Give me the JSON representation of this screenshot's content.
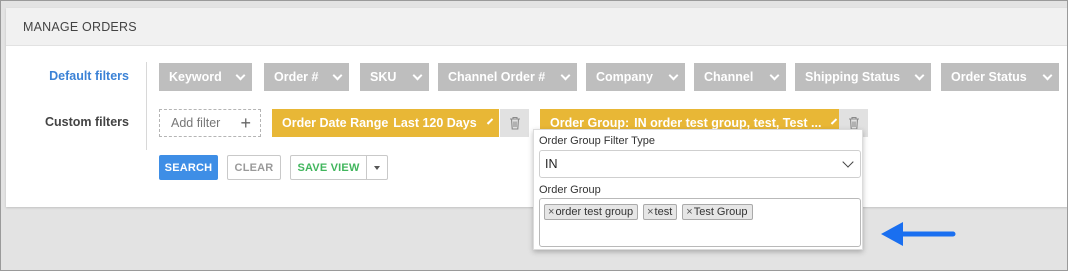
{
  "header": {
    "title": "MANAGE ORDERS"
  },
  "labels": {
    "default_filters": "Default filters",
    "custom_filters": "Custom filters"
  },
  "default_filters": [
    {
      "label": "Keyword"
    },
    {
      "label": "Order #"
    },
    {
      "label": "SKU"
    },
    {
      "label": "Channel Order #"
    },
    {
      "label": "Company"
    },
    {
      "label": "Channel"
    },
    {
      "label": "Shipping Status"
    },
    {
      "label": "Order Status"
    }
  ],
  "custom_filters": {
    "add_filter_label": "Add filter",
    "date_range": {
      "label": "Order Date Range",
      "value": "Last 120 Days"
    },
    "order_group": {
      "label": "Order Group:",
      "value": "IN order test group, test, Test ..."
    }
  },
  "buttons": {
    "search": "SEARCH",
    "clear": "CLEAR",
    "save_view": "SAVE VIEW"
  },
  "popup": {
    "filter_type_label": "Order Group Filter Type",
    "filter_type_value": "IN",
    "order_group_label": "Order Group",
    "tags": [
      "order test group",
      "test",
      "Test Group"
    ]
  },
  "colors": {
    "accent_blue": "#3e8ee6",
    "chip_gray": "#bebebe",
    "chip_gold": "#e8b736",
    "save_green": "#41b65d",
    "arrow_blue": "#1a6ff0"
  },
  "icons": {
    "chevron": "chevron-down-icon",
    "plus": "plus-icon",
    "trash": "trash-icon",
    "tag_remove": "close-icon",
    "annotation": "arrow-left-icon"
  }
}
